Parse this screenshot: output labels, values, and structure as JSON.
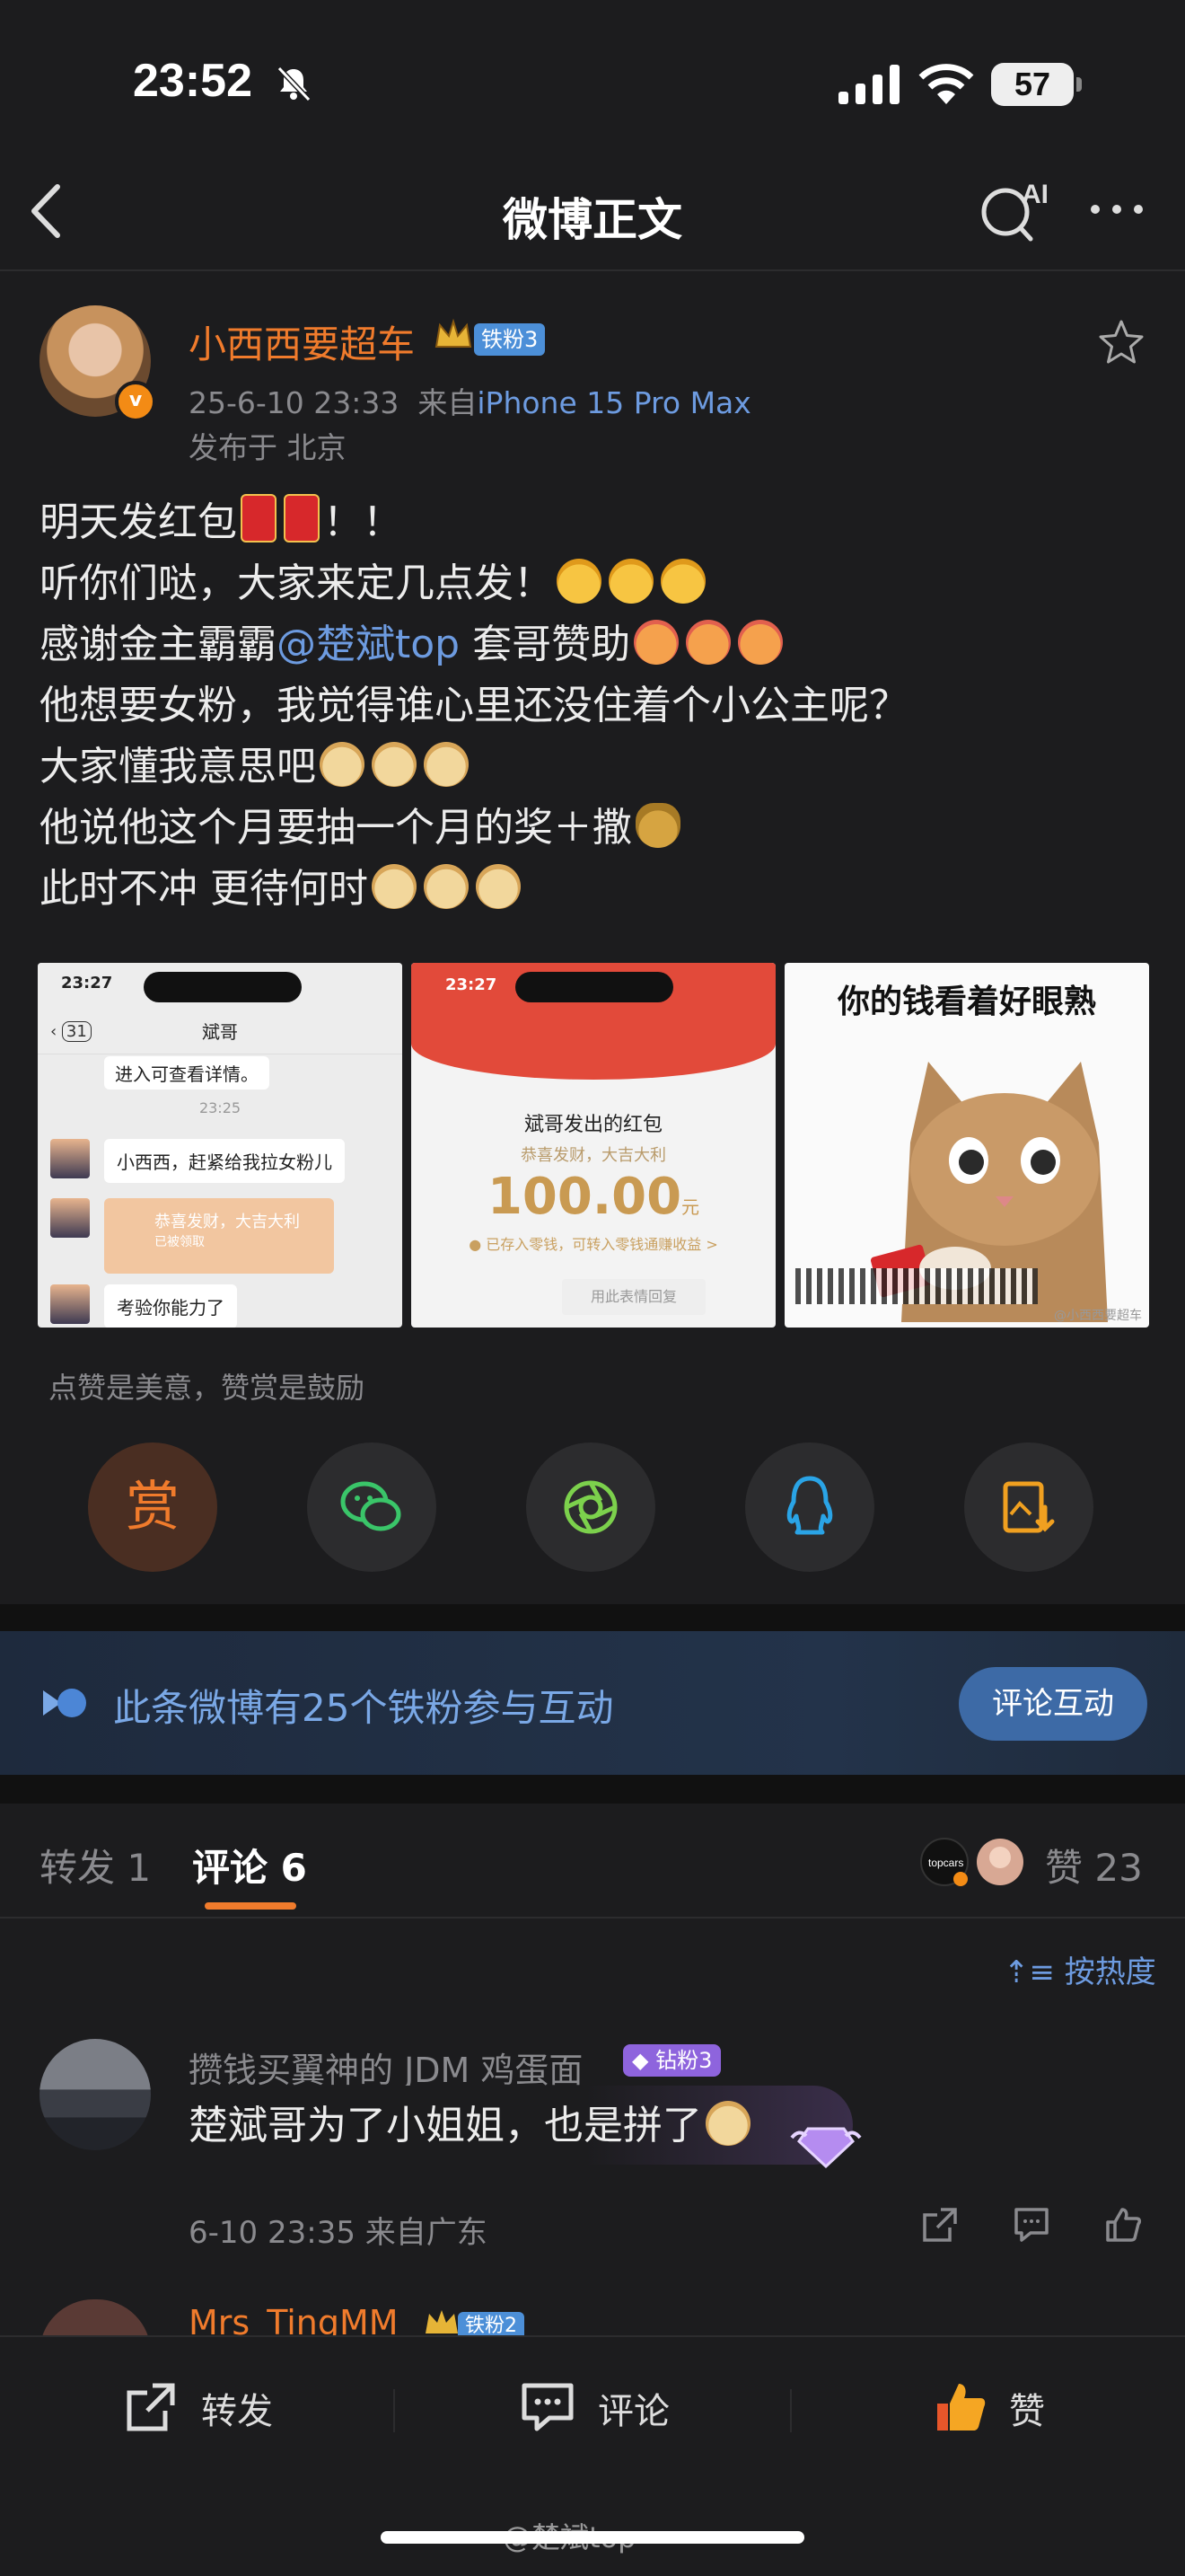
{
  "status_bar": {
    "time": "23:52",
    "battery": "57"
  },
  "nav": {
    "title": "微博正文",
    "ai_label": "AI"
  },
  "post": {
    "author": "小西西要超车",
    "author_fan_badge": "铁粉3",
    "date": "25-6-10 23:33",
    "source_prefix": "来自",
    "device": "iPhone 15 Pro Max",
    "location": "发布于 北京",
    "lines": {
      "l1": "明天发红包",
      "l1_end": "！！",
      "l2": "听你们哒，大家来定几点发！",
      "l3_a": "感谢金主霸霸",
      "l3_mention": "@楚斌top",
      "l3_b": "套哥赞助",
      "l4": "他想要女粉，我觉得谁心里还没住着个小公主呢？",
      "l5": "大家懂我意思吧",
      "l6": "他说他这个月要抽一个月的奖＋撒",
      "l7": "此时不冲 更待何时"
    }
  },
  "images": {
    "chat": {
      "time": "23:27",
      "title": "斌哥",
      "back_count": "31",
      "top_note": "进入可查看详情。",
      "chat_time": "23:25",
      "msg1": "小西西，赶紧给我拉女粉儿",
      "packet_text": "恭喜发财，大吉大利",
      "packet_sub": "已被领取",
      "msg2": "考验你能力了"
    },
    "packet": {
      "time": "23:27",
      "title": "斌哥发出的红包",
      "wish": "恭喜发财，大吉大利",
      "amount": "100.00",
      "unit": "元",
      "note": "● 已存入零钱，可转入零钱通赚收益 >",
      "reply_btn": "用此表情回复"
    },
    "meme": {
      "caption": "你的钱看着好眼熟",
      "watermark": "@小西西要超车"
    }
  },
  "reward": {
    "tip": "点赞是美意，赞赏是鼓励",
    "reward_label": "赏"
  },
  "banner": {
    "text": "此条微博有25个铁粉参与互动",
    "button": "评论互动"
  },
  "tabs": {
    "repost": "转发 1",
    "comments": "评论 6",
    "likes": "赞 23",
    "sort": "按热度"
  },
  "comments": [
    {
      "name": "攒钱买翼神的 JDM 鸡蛋面",
      "badge": "钻粉3",
      "text": "楚斌哥为了小姐姐，也是拼了",
      "meta": "6-10 23:35 来自广东"
    },
    {
      "name": "Mrs_TingMM",
      "badge": "铁粉2"
    }
  ],
  "bottom_bar": {
    "repost": "转发",
    "comment": "评论",
    "like": "赞"
  },
  "watermark": "@楚斌top",
  "colors": {
    "accent": "#f07b2c",
    "link": "#6d9be0",
    "bg": "#1c1c1e"
  }
}
